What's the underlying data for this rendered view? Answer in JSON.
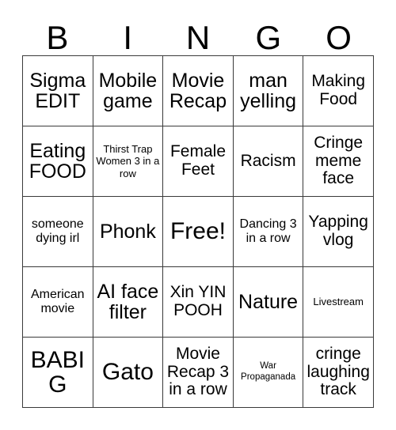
{
  "card": {
    "title": "BINGO",
    "header_letters": [
      "B",
      "I",
      "N",
      "G",
      "O"
    ],
    "border_color": "#3a3a3a",
    "background_color": "#ffffff",
    "text_color": "#000000",
    "rows": 5,
    "columns": 5,
    "cells": [
      [
        {
          "text": "Sigma EDIT",
          "size": "fs-lg"
        },
        {
          "text": "Mobile game",
          "size": "fs-lg"
        },
        {
          "text": "Movie Recap",
          "size": "fs-lg"
        },
        {
          "text": "man yelling",
          "size": "fs-lg"
        },
        {
          "text": "Making Food",
          "size": "fs-md"
        }
      ],
      [
        {
          "text": "Eating FOOD",
          "size": "fs-lg"
        },
        {
          "text": "Thirst Trap Women 3 in a row",
          "size": "fs-xs"
        },
        {
          "text": "Female Feet",
          "size": "fs-md"
        },
        {
          "text": "Racism",
          "size": "fs-md"
        },
        {
          "text": "Cringe meme face",
          "size": "fs-md"
        }
      ],
      [
        {
          "text": "someone dying irl",
          "size": "fs-sm"
        },
        {
          "text": "Phonk",
          "size": "fs-lg"
        },
        {
          "text": "Free!",
          "size": "fs-xl"
        },
        {
          "text": "Dancing 3 in a row",
          "size": "fs-sm"
        },
        {
          "text": "Yapping vlog",
          "size": "fs-md"
        }
      ],
      [
        {
          "text": "American movie",
          "size": "fs-sm"
        },
        {
          "text": "AI face filter",
          "size": "fs-lg"
        },
        {
          "text": "Xin YIN POOH",
          "size": "fs-md"
        },
        {
          "text": "Nature",
          "size": "fs-lg"
        },
        {
          "text": "Livestream",
          "size": "fs-xs"
        }
      ],
      [
        {
          "text": "BABIG",
          "size": "fs-xl"
        },
        {
          "text": "Gato",
          "size": "fs-xl"
        },
        {
          "text": "Movie Recap 3 in a row",
          "size": "fs-md"
        },
        {
          "text": "War Propaganada",
          "size": "fs-xxs"
        },
        {
          "text": "cringe laughing track",
          "size": "fs-md"
        }
      ]
    ]
  }
}
